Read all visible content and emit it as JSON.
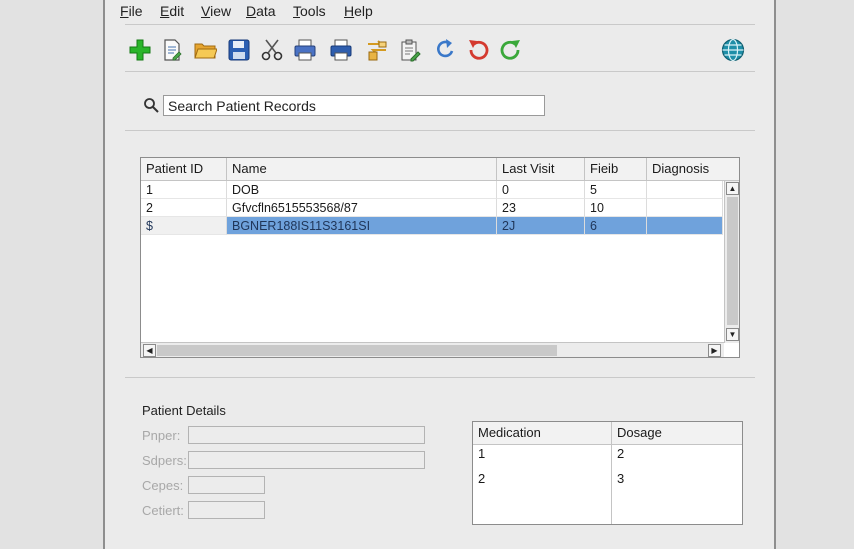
{
  "menu": [
    {
      "label": "File",
      "ul": "F",
      "rest": "ile"
    },
    {
      "label": "Edit",
      "ul": "E",
      "rest": "dit"
    },
    {
      "label": "View",
      "ul": "V",
      "rest": "iew"
    },
    {
      "label": "Data",
      "ul": "D",
      "rest": "ata"
    },
    {
      "label": "Tools",
      "ul": "T",
      "rest": "ools"
    },
    {
      "label": "Help",
      "ul": "H",
      "rest": "elp"
    }
  ],
  "toolbar": {
    "icons": [
      "add-icon",
      "edit-document-icon",
      "open-folder-icon",
      "save-icon",
      "cut-icon",
      "print-preview-icon",
      "print-icon",
      "transfer-icon",
      "clipboard-edit-icon",
      "refresh-icon",
      "undo-icon",
      "redo-icon",
      "globe-icon"
    ],
    "colors": {
      "add": "#2bb52b",
      "folder": "#f0b63a",
      "save": "#2c5fb3",
      "refresh": "#3a78c9",
      "undo": "#d43a2f",
      "redo": "#3aa83a",
      "globe": "#1e8fa8"
    }
  },
  "search": {
    "value": "Search Patient Records"
  },
  "grid": {
    "columns": [
      "Patient ID",
      "Name",
      "Last Visit",
      "Fieib",
      "Diagnosis"
    ],
    "rows": [
      [
        "1",
        "DOB",
        "0",
        "5",
        ""
      ],
      [
        "2",
        "Gfvcfln6515553568/87",
        "23",
        "10",
        ""
      ],
      [
        "$",
        "BGNER188IS11S3161SI",
        "2J",
        "6",
        ""
      ]
    ],
    "selected_row": 3
  },
  "details": {
    "title": "Patient Details",
    "fields": [
      {
        "label": "Pnper:",
        "value": ""
      },
      {
        "label": "Sdpers:",
        "value": ""
      },
      {
        "label": "Cepes:",
        "value": ""
      },
      {
        "label": "Cetiert:",
        "value": ""
      }
    ]
  },
  "medication": {
    "columns": [
      "Medication",
      "Dosage"
    ],
    "rows": [
      [
        "1",
        "2"
      ],
      [
        "2",
        "3"
      ]
    ]
  },
  "colors": {
    "selection": "#6fa2dc",
    "window_bg": "#ebebeb"
  }
}
